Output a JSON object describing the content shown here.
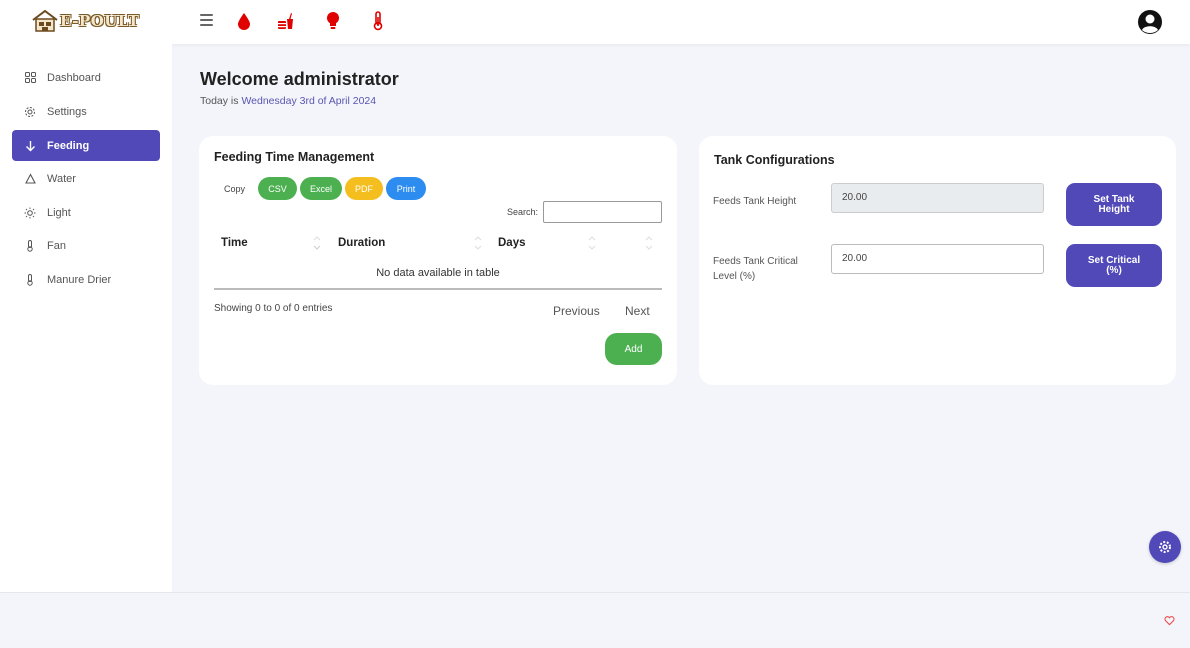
{
  "brand": {
    "logo_text": "E-POULT"
  },
  "topbar": {
    "icons": [
      "menu-icon",
      "water-drop-icon",
      "feed-icon",
      "bulb-icon",
      "thermometer-icon"
    ],
    "accent": "#e00000"
  },
  "sidebar": {
    "items": [
      {
        "label": "Dashboard",
        "icon": "grid-icon"
      },
      {
        "label": "Settings",
        "icon": "gear-icon"
      },
      {
        "label": "Feeding",
        "icon": "arrow-down-icon",
        "active": true
      },
      {
        "label": "Water",
        "icon": "drop-outline-icon"
      },
      {
        "label": "Light",
        "icon": "sun-icon"
      },
      {
        "label": "Fan",
        "icon": "thermometer-icon"
      },
      {
        "label": "Manure Drier",
        "icon": "thermometer-icon"
      }
    ]
  },
  "welcome": {
    "title": "Welcome administrator",
    "prefix": "Today is ",
    "date": "Wednesday 3rd of April 2024"
  },
  "feeding": {
    "title": "Feeding Time Management",
    "buttons": {
      "copy": "Copy",
      "csv": "CSV",
      "excel": "Excel",
      "pdf": "PDF",
      "print": "Print"
    },
    "search_label": "Search:",
    "search_value": "",
    "columns": [
      "Time",
      "Duration",
      "Days"
    ],
    "empty_message": "No data available in table",
    "info": "Showing 0 to 0 of 0 entries",
    "previous": "Previous",
    "next": "Next",
    "add": "Add"
  },
  "tank": {
    "title": "Tank Configurations",
    "height_label": "Feeds Tank Height",
    "height_value": "20.00",
    "height_button": "Set Tank Height",
    "critical_label": "Feeds Tank Critical Level (%)",
    "critical_value": "20.00",
    "critical_button": "Set Critical (%)"
  },
  "colors": {
    "primary": "#5149b8",
    "success": "#4cb050",
    "warning": "#f4be1e",
    "info": "#2c8cf0",
    "danger": "#e00000"
  }
}
